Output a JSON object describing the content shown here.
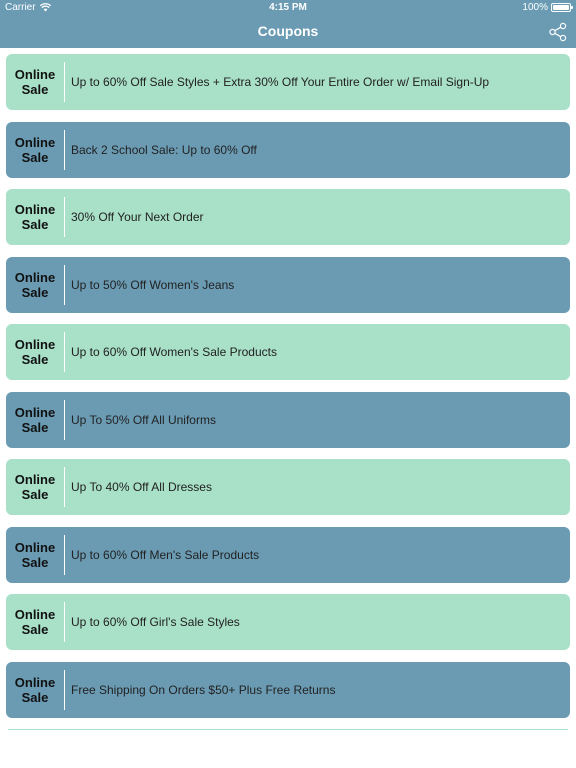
{
  "status_bar": {
    "carrier": "Carrier",
    "time": "4:15 PM",
    "battery": "100%"
  },
  "header": {
    "title": "Coupons",
    "share_icon": "share-icon"
  },
  "colors": {
    "header": "#6a9bb3",
    "green_row": "#a8e0c8",
    "blue_row": "#6a9bb3"
  },
  "coupons": [
    {
      "badge": "Online\nSale",
      "text": "Up to 60% Off Sale Styles + Extra 30% Off Your Entire Order w/ Email Sign-Up"
    },
    {
      "badge": "Online\nSale",
      "text": "Back 2 School Sale: Up to 60% Off"
    },
    {
      "badge": "Online\nSale",
      "text": "30% Off Your Next Order"
    },
    {
      "badge": "Online\nSale",
      "text": "Up to 50% Off Women's Jeans"
    },
    {
      "badge": "Online\nSale",
      "text": "Up to 60% Off Women's Sale Products"
    },
    {
      "badge": "Online\nSale",
      "text": "Up To 50% Off All Uniforms"
    },
    {
      "badge": "Online\nSale",
      "text": "Up To 40% Off All Dresses"
    },
    {
      "badge": "Online\nSale",
      "text": "Up to 60% Off Men's Sale Products"
    },
    {
      "badge": "Online\nSale",
      "text": "Up to 60% Off Girl's Sale Styles"
    },
    {
      "badge": "Online\nSale",
      "text": "Free Shipping On Orders $50+ Plus Free Returns"
    }
  ]
}
